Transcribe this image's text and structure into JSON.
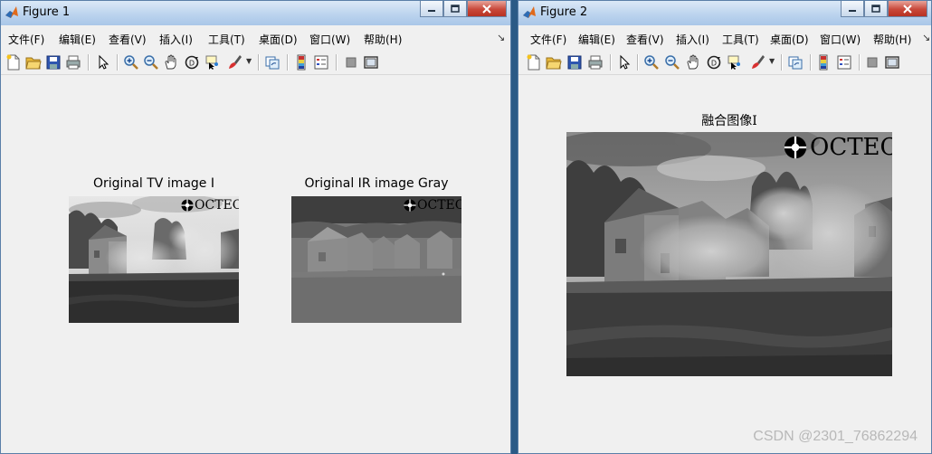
{
  "figure1": {
    "title": "Figure 1",
    "menu": [
      "文件(F)",
      "编辑(E)",
      "查看(V)",
      "插入(I)",
      "工具(T)",
      "桌面(D)",
      "窗口(W)",
      "帮助(H)"
    ],
    "axes": [
      {
        "title": "Original TV image I",
        "logo": "OCTEC"
      },
      {
        "title": "Original IR image Gray",
        "logo": "OCTEC"
      }
    ]
  },
  "figure2": {
    "title": "Figure 2",
    "menu": [
      "文件(F)",
      "编辑(E)",
      "查看(V)",
      "插入(I)",
      "工具(T)",
      "桌面(D)",
      "窗口(W)",
      "帮助(H)"
    ],
    "axes": [
      {
        "title": "融合图像I",
        "logo": "OCTEC"
      }
    ]
  },
  "watermark": "CSDN @2301_76862294",
  "toolbar_icons": [
    "new-figure-icon",
    "open-file-icon",
    "save-icon",
    "print-icon",
    "select-arrow-icon",
    "zoom-in-icon",
    "zoom-out-icon",
    "pan-hand-icon",
    "rotate-3d-icon",
    "data-cursor-icon",
    "brush-icon",
    "link-plot-icon",
    "colorbar-icon",
    "legend-icon",
    "hide-plot-tools-icon",
    "show-plot-tools-icon"
  ]
}
